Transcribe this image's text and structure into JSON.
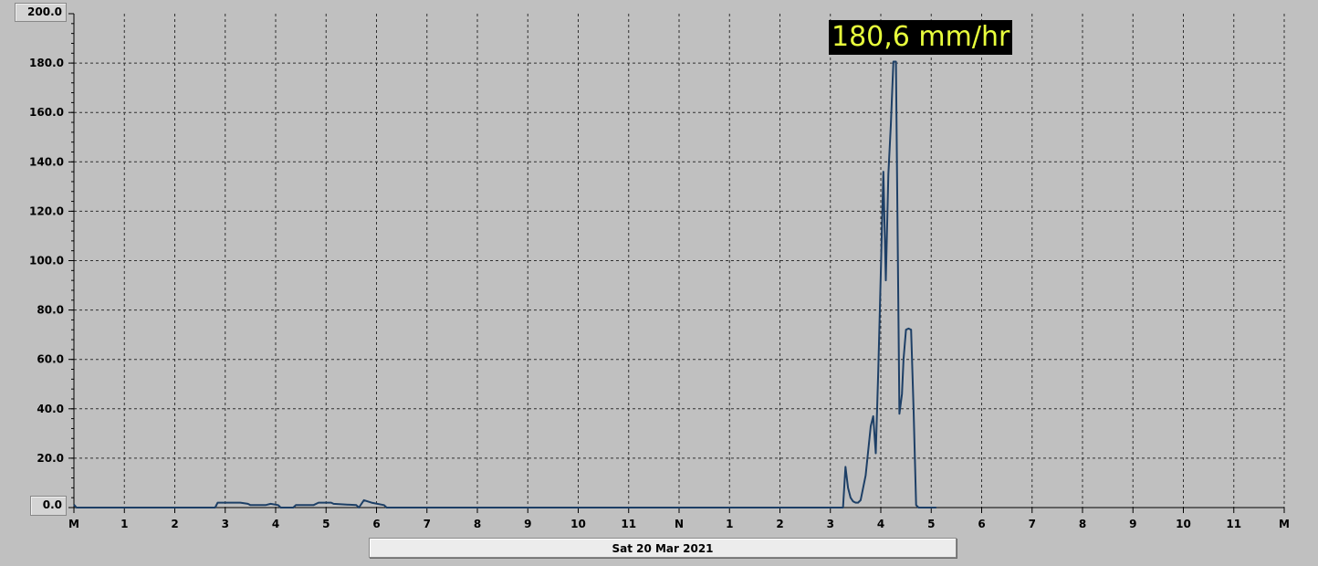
{
  "chart_data": {
    "type": "line",
    "title": "",
    "xlabel": "",
    "ylabel": "",
    "unit": "mm/hr",
    "date_label": "Sat 20 Mar 2021",
    "peak_label": "180,6 mm/hr",
    "ylim": [
      0,
      200
    ],
    "xlim": [
      0,
      24
    ],
    "y_ticks": [
      "0.0",
      "20.0",
      "40.0",
      "60.0",
      "80.0",
      "100.0",
      "120.0",
      "140.0",
      "160.0",
      "180.0",
      "200.0"
    ],
    "x_ticks": [
      "M",
      "1",
      "2",
      "3",
      "4",
      "5",
      "6",
      "7",
      "8",
      "9",
      "10",
      "11",
      "N",
      "1",
      "2",
      "3",
      "4",
      "5",
      "6",
      "7",
      "8",
      "9",
      "10",
      "11",
      "M"
    ],
    "grid": true,
    "line_color": "#1d3f66",
    "x": [
      0,
      0.05,
      0.1,
      2.8,
      2.85,
      3.3,
      3.45,
      3.5,
      3.8,
      3.9,
      4.05,
      4.1,
      4.35,
      4.4,
      4.75,
      4.85,
      5.1,
      5.15,
      5.6,
      5.65,
      5.75,
      5.9,
      6.15,
      6.2,
      6.25,
      15.25,
      15.3,
      15.35,
      15.4,
      15.45,
      15.5,
      15.55,
      15.6,
      15.7,
      15.8,
      15.85,
      15.9,
      15.95,
      16.0,
      16.05,
      16.1,
      16.15,
      16.2,
      16.25,
      16.3,
      16.33,
      16.37,
      16.42,
      16.45,
      16.5,
      16.55,
      16.6,
      16.65,
      16.7,
      16.75,
      16.82,
      16.86,
      16.95,
      17.0,
      17.05,
      17.1
    ],
    "y": [
      1.2,
      0,
      0,
      0,
      2,
      2,
      1.5,
      1,
      1,
      1.5,
      1,
      0,
      0,
      1,
      1,
      2,
      2,
      1.5,
      1,
      0,
      3,
      2,
      1,
      0,
      0,
      0,
      16.5,
      8,
      4,
      2.5,
      2,
      2,
      3,
      13,
      33,
      37,
      22,
      55,
      95,
      136,
      92,
      135,
      155,
      180.6,
      180.6,
      120,
      38,
      46,
      60,
      72,
      72.5,
      72,
      40,
      1,
      0,
      0,
      0,
      0,
      0,
      0,
      0
    ]
  }
}
